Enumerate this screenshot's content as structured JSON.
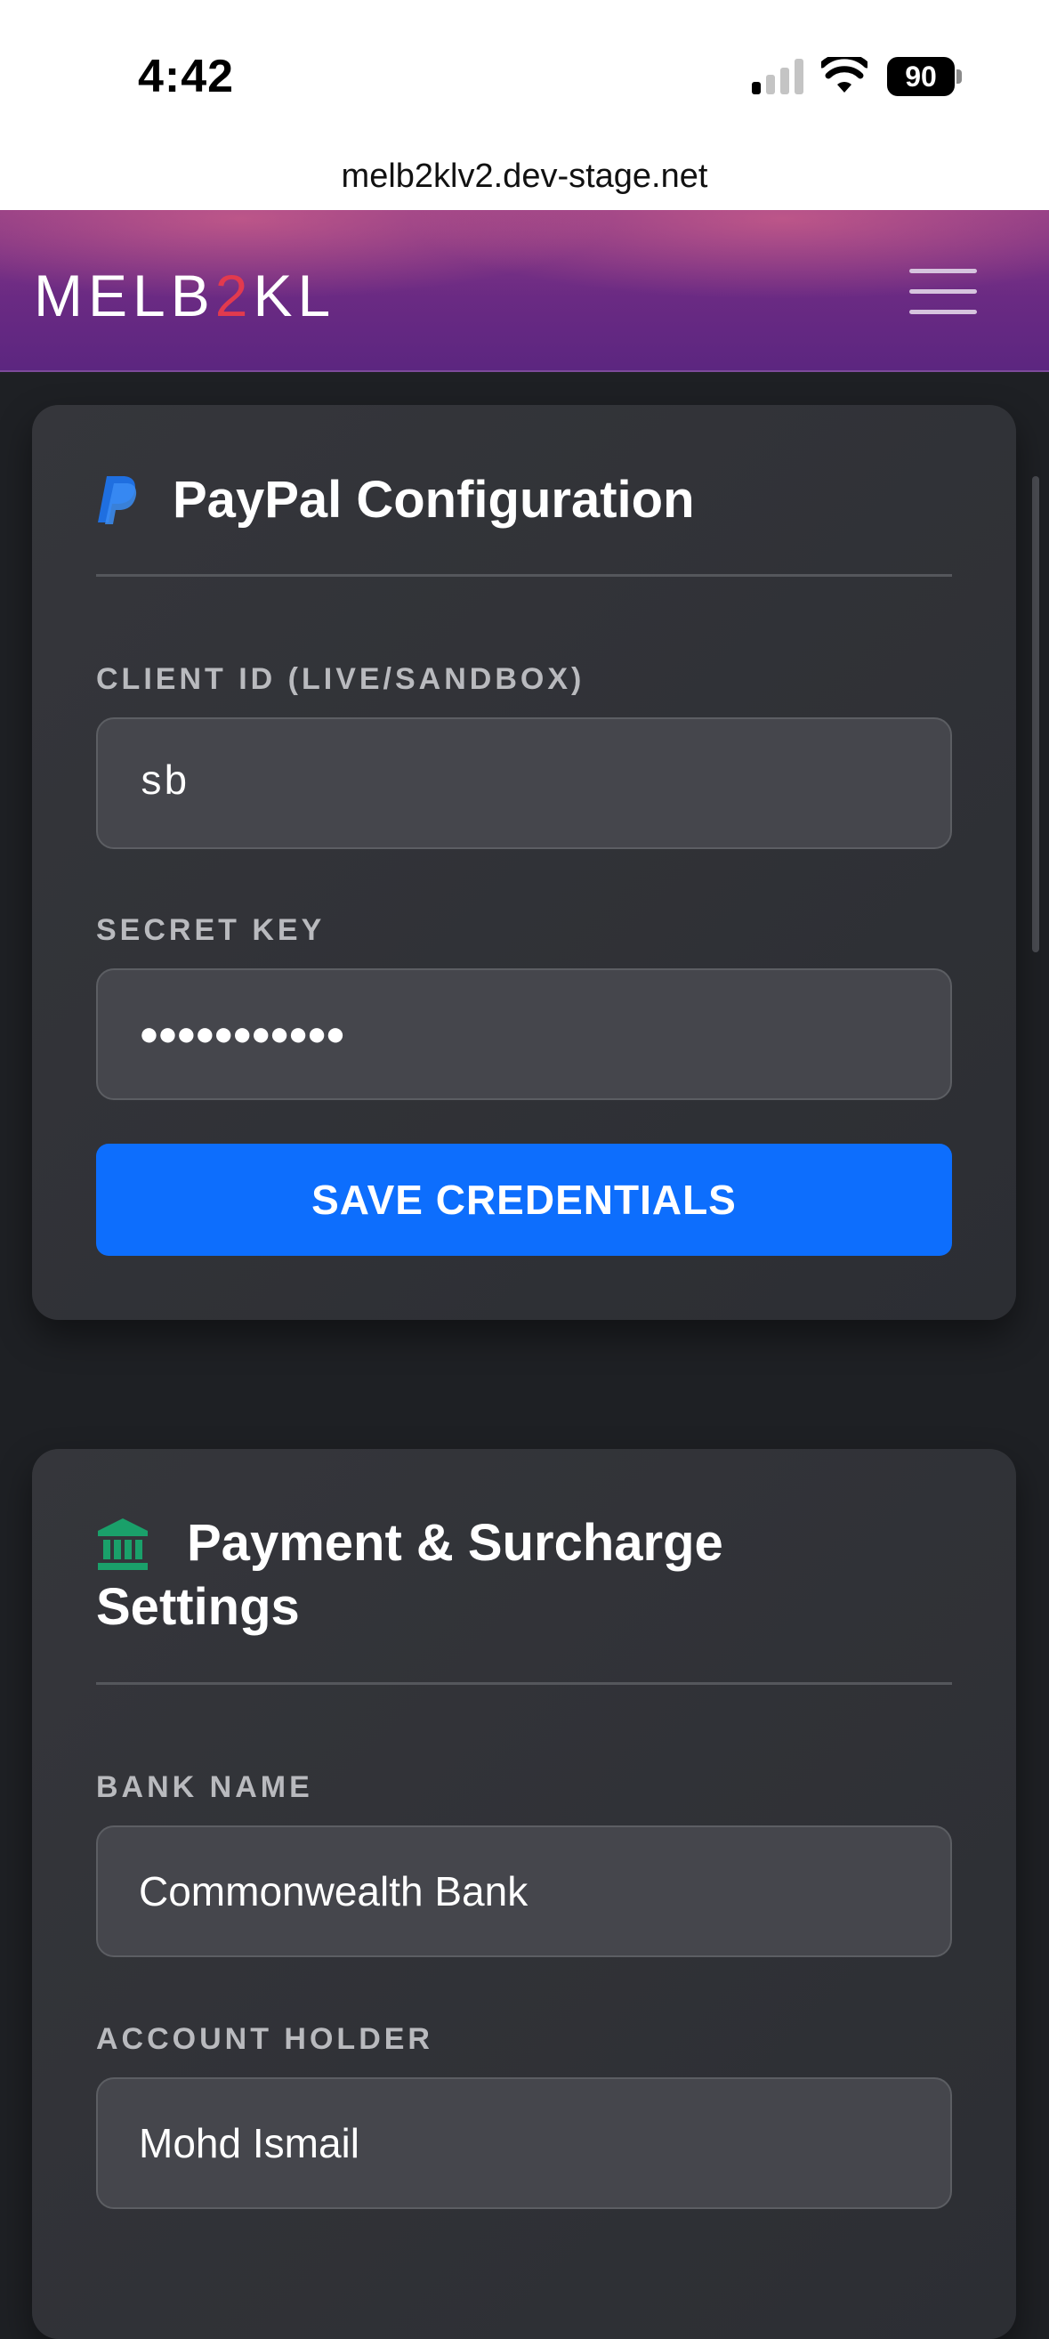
{
  "status_bar": {
    "time": "4:42",
    "battery_level": "90"
  },
  "browser": {
    "url": "melb2klv2.dev-stage.net"
  },
  "header": {
    "logo_prefix": "MELB",
    "logo_accent": "2",
    "logo_suffix": "KL",
    "accent_color": "#e23a4e",
    "menu_icon": "hamburger-icon"
  },
  "paypal_card": {
    "icon": "paypal-icon",
    "title": "PayPal Configuration",
    "client_id": {
      "label": "CLIENT ID (LIVE/SANDBOX)",
      "value": "sb"
    },
    "secret_key": {
      "label": "SECRET KEY",
      "value": "●●●●●●●●●●●"
    },
    "save_label": "SAVE CREDENTIALS",
    "save_color": "#0d6efd"
  },
  "payment_card": {
    "icon": "bank-icon",
    "title_line1": "Payment & Surcharge",
    "title_line2": "Settings",
    "bank_name": {
      "label": "BANK NAME",
      "value": "Commonwealth Bank"
    },
    "account_holder": {
      "label": "ACCOUNT HOLDER",
      "value": "Mohd Ismail"
    }
  }
}
